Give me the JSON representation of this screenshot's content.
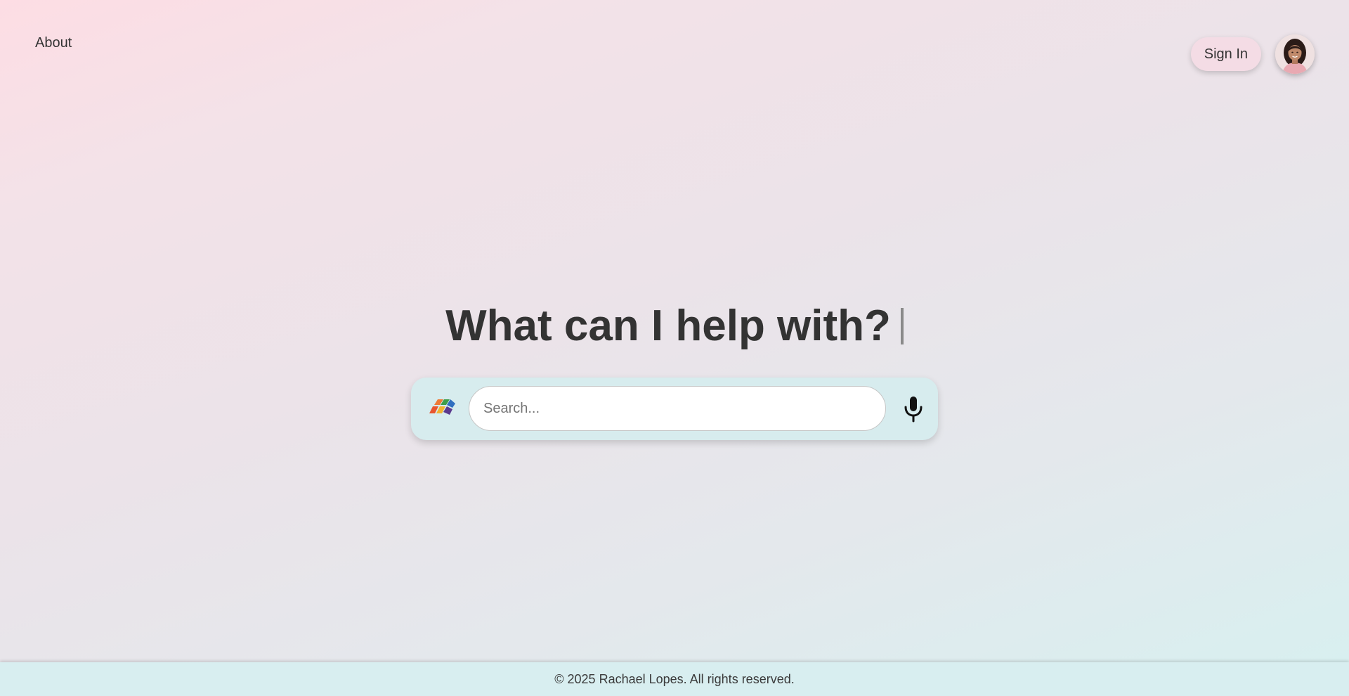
{
  "nav": {
    "about_label": "About"
  },
  "header": {
    "signin_label": "Sign In",
    "avatar_icon": "user-avatar-photo"
  },
  "hero": {
    "title": "What can I help with?"
  },
  "search": {
    "placeholder": "Search...",
    "value": "",
    "logo_icon": "multicolor-logo-icon",
    "mic_icon": "microphone-icon"
  },
  "footer": {
    "copyright": "© 2025 Rachael Lopes. All rights reserved."
  },
  "colors": {
    "text": "#333333",
    "signin_bg": "#f4dce5",
    "search_bar_bg": "#d7ecee",
    "footer_bg": "#d8eef0",
    "gradient_start": "#fddde4",
    "gradient_end": "#d7f0f0"
  }
}
